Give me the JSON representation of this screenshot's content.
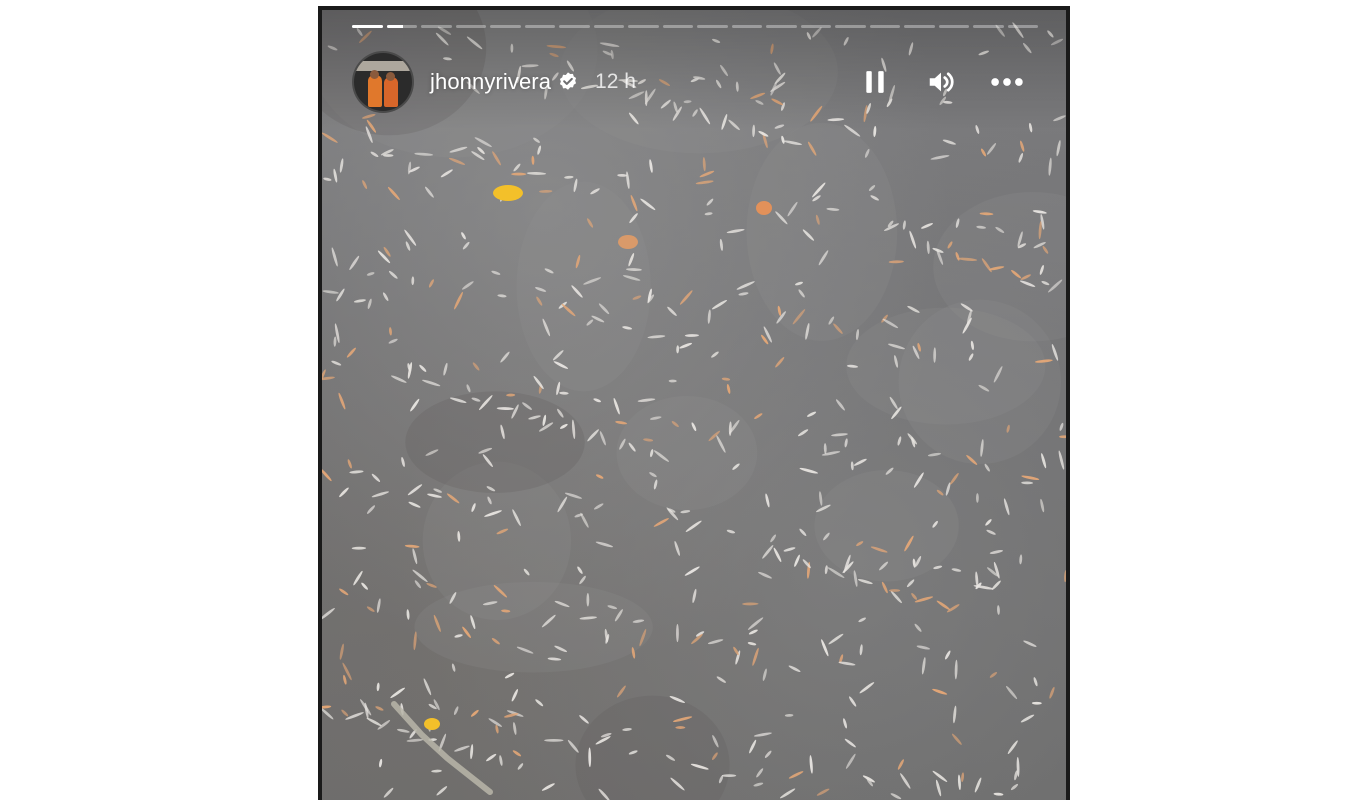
{
  "story": {
    "username": "jhonnyrivera",
    "verified": true,
    "time_ago": "12 h",
    "progress": {
      "segments": 20,
      "current_index": 1,
      "current_fraction": 0.55
    },
    "controls": {
      "pause_icon": "pause-icon",
      "volume_icon": "volume-icon",
      "more_icon": "more-options-icon"
    },
    "colors": {
      "water": "#757577",
      "fish_light": "#e9e6e2",
      "fish_orange": "#e6a877",
      "leaf_yellow": "#f3c02a"
    }
  }
}
